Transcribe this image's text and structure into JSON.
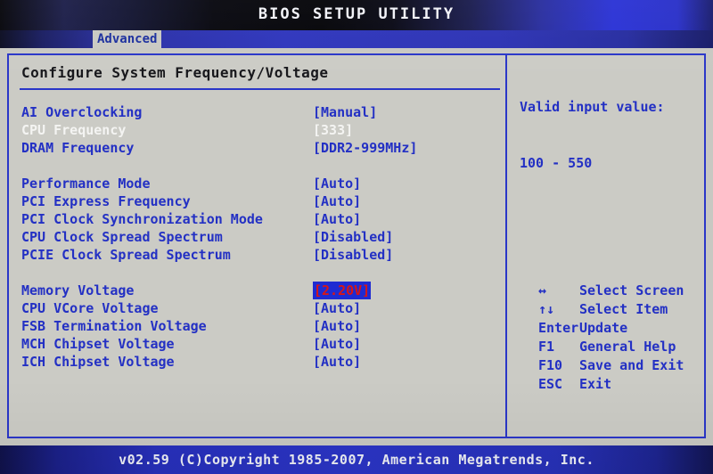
{
  "titlebar": {
    "title": "BIOS SETUP UTILITY"
  },
  "tabs": [
    {
      "label": "Advanced",
      "active": true
    }
  ],
  "main": {
    "pane_title": "Configure System Frequency/Voltage",
    "groups": [
      {
        "rows": [
          {
            "label": "AI Overclocking",
            "value": "[Manual]",
            "style": "blue"
          },
          {
            "label": "CPU Frequency",
            "value": "[333]",
            "style": "white"
          },
          {
            "label": "DRAM Frequency",
            "value": "[DDR2-999MHz]",
            "style": "blue"
          }
        ]
      },
      {
        "rows": [
          {
            "label": "Performance Mode",
            "value": "[Auto]",
            "style": "blue"
          },
          {
            "label": "PCI Express Frequency",
            "value": "[Auto]",
            "style": "blue"
          },
          {
            "label": "PCI Clock Synchronization Mode",
            "value": "[Auto]",
            "style": "blue"
          },
          {
            "label": "CPU Clock Spread Spectrum",
            "value": "[Disabled]",
            "style": "blue"
          },
          {
            "label": "PCIE Clock Spread Spectrum",
            "value": "[Disabled]",
            "style": "blue"
          }
        ]
      },
      {
        "rows": [
          {
            "label": "Memory Voltage",
            "value": "[2.20V]",
            "style": "selected"
          },
          {
            "label": "CPU VCore Voltage",
            "value": "[Auto]",
            "style": "blue"
          },
          {
            "label": "FSB Termination Voltage",
            "value": "[Auto]",
            "style": "blue"
          },
          {
            "label": "MCH Chipset Voltage",
            "value": "[Auto]",
            "style": "blue"
          },
          {
            "label": "ICH Chipset Voltage",
            "value": "[Auto]",
            "style": "blue"
          }
        ]
      }
    ]
  },
  "help": {
    "line1": "Valid input value:",
    "line2": "100 - 550"
  },
  "legend": [
    {
      "key": "↔",
      "desc": "Select Screen",
      "icon": "left-right-arrow-icon"
    },
    {
      "key": "↑↓",
      "desc": "Select Item",
      "icon": "up-down-arrow-icon"
    },
    {
      "key": "Enter",
      "desc": "Update",
      "icon": "enter-key"
    },
    {
      "key": "F1",
      "desc": "General Help",
      "icon": "f1-key"
    },
    {
      "key": "F10",
      "desc": "Save and Exit",
      "icon": "f10-key"
    },
    {
      "key": "ESC",
      "desc": "Exit",
      "icon": "esc-key"
    }
  ],
  "footer": {
    "text": "v02.59 (C)Copyright 1985-2007, American Megatrends, Inc."
  },
  "colors": {
    "text_blue": "#2330c4",
    "text_white": "#f4f4f2",
    "highlight_bg": "#1f2bd2",
    "highlight_fg": "#d81616",
    "background": "#cbcbc5",
    "border": "#2a36c8"
  }
}
